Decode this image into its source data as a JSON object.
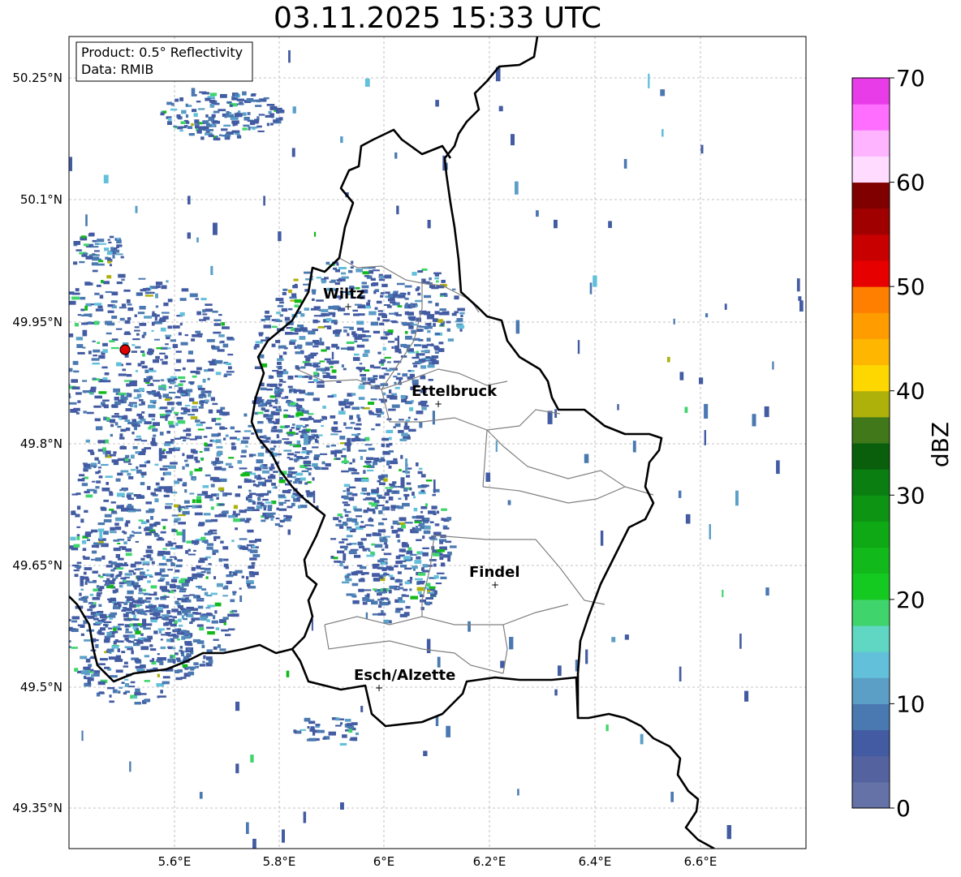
{
  "title": "03.11.2025 15:33 UTC",
  "info": {
    "product": "Product: 0.5° Reflectivity",
    "data": "Data: RMIB"
  },
  "axes": {
    "lon_ticks": [
      "5.6°E",
      "5.8°E",
      "6°E",
      "6.2°E",
      "6.4°E",
      "6.6°E"
    ],
    "lat_ticks": [
      "50.25°N",
      "50.1°N",
      "49.95°N",
      "49.8°N",
      "49.65°N",
      "49.5°N",
      "49.35°N"
    ]
  },
  "cities": [
    {
      "name": "Wiltz"
    },
    {
      "name": "Ettelbruck"
    },
    {
      "name": "Findel"
    },
    {
      "name": "Esch/Alzette"
    }
  ],
  "colorbar": {
    "label": "dBZ",
    "ticks": [
      "0",
      "10",
      "20",
      "30",
      "40",
      "50",
      "60",
      "70"
    ],
    "colors": [
      "#6472a8",
      "#54639f",
      "#425ba2",
      "#4a78b0",
      "#5b9fc7",
      "#63c0da",
      "#5fd7c2",
      "#3fd56c",
      "#14c91f",
      "#12b91b",
      "#0ea914",
      "#0c9412",
      "#0b7e12",
      "#095f0c",
      "#41781a",
      "#aeb10a",
      "#ffd700",
      "#ffb600",
      "#ff9d00",
      "#ff7f00",
      "#e60000",
      "#c80000",
      "#a00000",
      "#800000",
      "#ffdcff",
      "#ffb4ff",
      "#ff6eff",
      "#e83ce8"
    ]
  },
  "radar_site": {
    "name": "radar-site"
  }
}
